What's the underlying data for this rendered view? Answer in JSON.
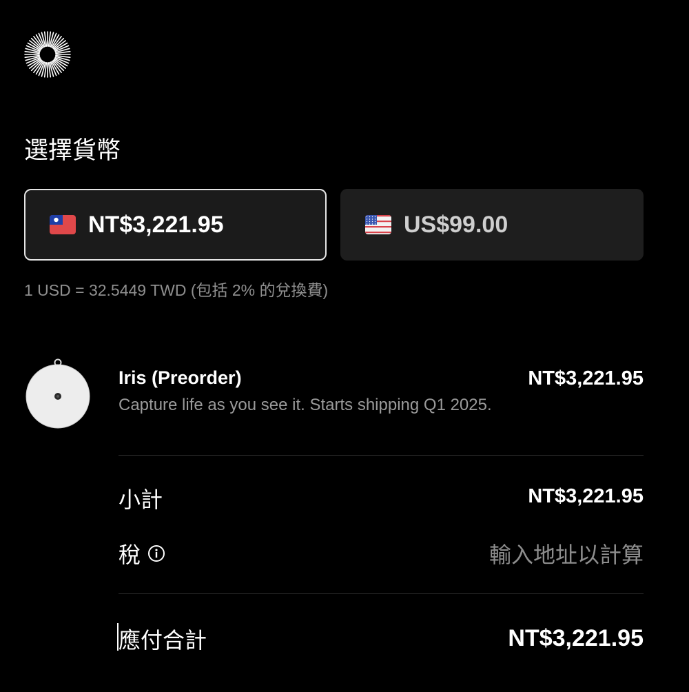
{
  "logo": {
    "icon": "sunburst-logo-icon"
  },
  "currency_section": {
    "title": "選擇貨幣",
    "options": [
      {
        "flag": "taiwan-flag-icon",
        "label": "NT$3,221.95",
        "selected": true
      },
      {
        "flag": "us-flag-icon",
        "label": "US$99.00",
        "selected": false
      }
    ],
    "rate_note": "1 USD = 32.5449 TWD (包括 2% 的兌換費)"
  },
  "order": {
    "item": {
      "image": "iris-device-icon",
      "name": "Iris (Preorder)",
      "description": "Capture life as you see it. Starts shipping Q1 2025.",
      "price": "NT$3,221.95"
    },
    "subtotal": {
      "label": "小計",
      "value": "NT$3,221.95"
    },
    "tax": {
      "label": "稅",
      "info_icon": "info-icon",
      "value": "輸入地址以計算"
    },
    "total": {
      "label": "應付合計",
      "value": "NT$3,221.95"
    }
  },
  "colors": {
    "background": "#000000",
    "card": "#1e1e1e",
    "selected_border": "#e5e5e5",
    "muted_text": "#8f8f8f",
    "taiwan_red": "#e0484a",
    "taiwan_blue": "#1f3fa8"
  }
}
